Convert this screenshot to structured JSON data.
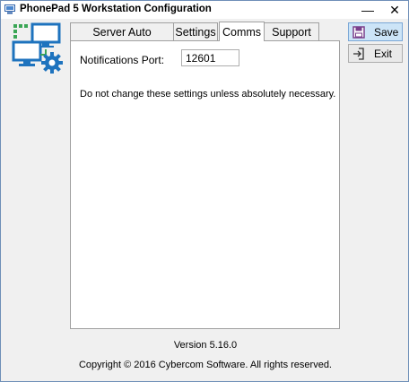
{
  "window": {
    "title": "PhonePad 5 Workstation Configuration",
    "minimize_glyph": "—",
    "close_glyph": "✕"
  },
  "tabs": [
    {
      "label": "Server Auto Discovery",
      "active": false
    },
    {
      "label": "Settings",
      "active": false
    },
    {
      "label": "Comms",
      "active": true
    },
    {
      "label": "Support",
      "active": false
    }
  ],
  "comms": {
    "notifications_port_label": "Notifications Port:",
    "notifications_port_value": "12601",
    "warning_text": "Do not change these settings unless absolutely necessary."
  },
  "buttons": {
    "save_label": "Save",
    "save_icon": "floppy-disk-icon",
    "exit_label": "Exit",
    "exit_icon": "exit-icon"
  },
  "footer": {
    "version": "Version 5.16.0",
    "copyright": "Copyright © 2016 Cybercom Software. All rights reserved."
  },
  "colors": {
    "accent_blue": "#1e73be",
    "logo_green": "#3aa655",
    "save_button_bg": "#cce4f7"
  }
}
